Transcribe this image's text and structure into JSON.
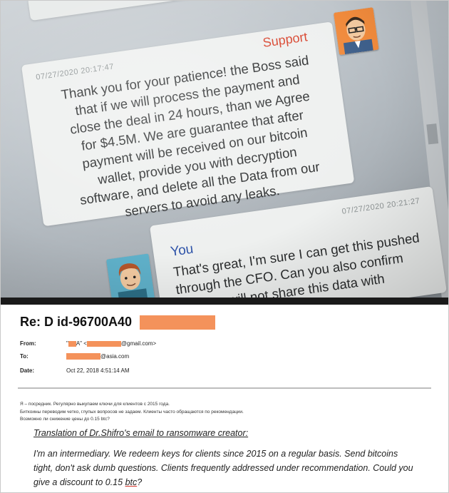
{
  "chat": {
    "support": {
      "sender": "Support",
      "timestamp": "07/27/2020 20:17:47",
      "lines": [
        "Thank you for your patience! the Boss said",
        "that if we will process the payment and",
        "close the deal in 24 hours, than we Agree",
        "for $4.5M. We are guarantee that after",
        "payment will be received on our bitcoin",
        "wallet, provide you with decryption",
        "software, and delete all the Data from our",
        "servers to avoid any leaks."
      ]
    },
    "you": {
      "sender": "You",
      "timestamp": "07/27/2020 20:21:27",
      "lines": [
        "That's great, I'm sure I can get this pushed",
        "through the CFO. Can you also confirm",
        "that you will not share this data with"
      ]
    }
  },
  "email": {
    "subject": "Re: D id-96700A40",
    "from_label": "From:",
    "from_prefix": "\"",
    "from_mid": "A\" <",
    "from_suffix": "@gmail.com>",
    "to_label": "To:",
    "to_suffix": "@asia.com",
    "date_label": "Date:",
    "date_value": "Oct 22, 2018 4:51:14 AM",
    "russian_lines": [
      "Я – посредник. Регулярно выкупаем ключи для клиентов с 2015 года.",
      "Биткоины переводим четко, глупых вопросов не задаем. Клиенты часто обращаются по рекомендации.",
      "Возможно ли снижение цены до 0.15 btc?"
    ],
    "translation_title": "Translation of Dr.Shifro's email to ransomware creator:",
    "translation_lines": [
      "I'm an intermediary. We redeem keys for clients since 2015 on a regular basis. Send bitcoins",
      "tight, don't ask dumb questions. Clients frequently addressed under recommendation. Could you"
    ],
    "translation_last_prefix": "give a discount to 0.15 ",
    "translation_last_btc": "btc",
    "translation_last_suffix": "?"
  },
  "colors": {
    "support_name": "#d8432c",
    "you_name": "#2d52a8",
    "redaction": "#f4925b"
  },
  "icons": [
    "support-avatar-icon",
    "you-avatar-icon"
  ]
}
